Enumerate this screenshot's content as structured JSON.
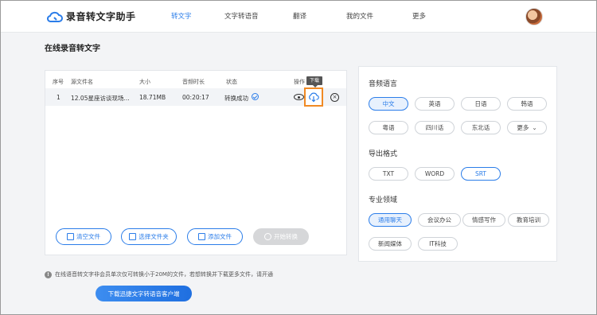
{
  "header": {
    "app_name": "录音转文字助手",
    "nav": [
      {
        "label": "转文字",
        "active": true
      },
      {
        "label": "文字转语音",
        "active": false
      },
      {
        "label": "翻译",
        "active": false
      },
      {
        "label": "我的文件",
        "active": false
      },
      {
        "label": "更多",
        "active": false
      }
    ]
  },
  "page_title": "在线录音转文字",
  "table": {
    "columns": [
      "序号",
      "源文件名",
      "大小",
      "音频时长",
      "状态",
      "操作"
    ],
    "rows": [
      {
        "index": "1",
        "filename": "12.05星座访谈现场...",
        "size": "18.71MB",
        "duration": "00:20:17",
        "status": "转换成功"
      }
    ],
    "tooltip": "下载"
  },
  "actions": {
    "clear": "清空文件",
    "folder": "选择文件夹",
    "add": "添加文件",
    "start": "开始转换"
  },
  "settings": {
    "language_title": "音频语言",
    "languages": [
      "中文",
      "英语",
      "日语",
      "韩语",
      "粤语",
      "四川话",
      "东北话",
      "更多"
    ],
    "format_title": "导出格式",
    "formats": [
      "TXT",
      "WORD",
      "SRT"
    ],
    "domain_title": "专业领域",
    "domains": [
      "通用聊天",
      "会议办公",
      "情感写作",
      "教育培训",
      "新闻媒体",
      "IT科技"
    ]
  },
  "notice": "在线语音转文字非会员单次仅可转换小于20M的文件，若想转换并下载更多文件，请开通",
  "client_button": "下载迅捷文字转语音客户端",
  "colors": {
    "accent": "#2b7de9",
    "highlight": "#f08a24"
  }
}
